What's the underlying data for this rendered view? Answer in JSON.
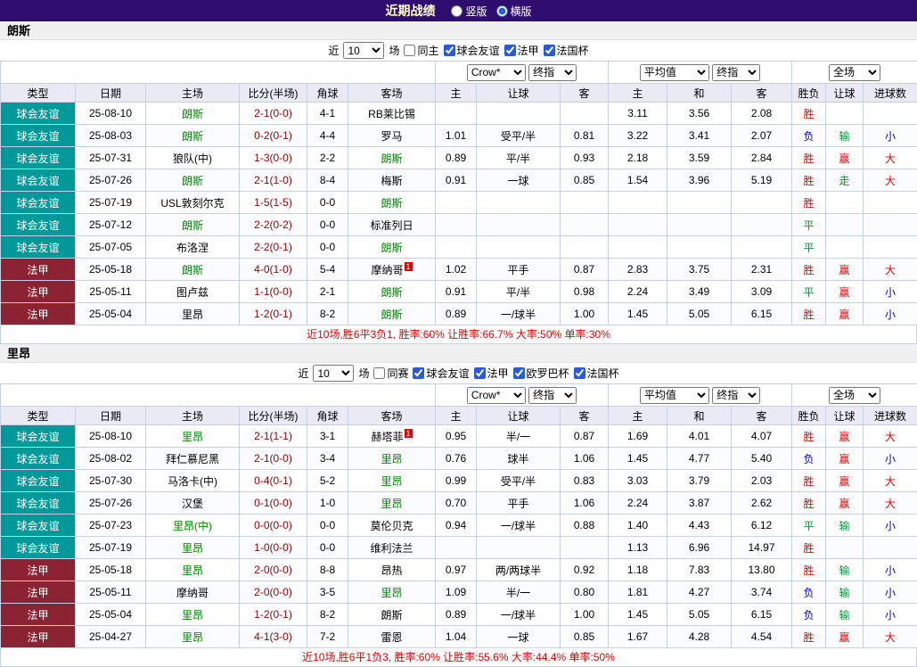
{
  "colors": {
    "topbar-bg": "#2e0d6e",
    "topbar-title": "#ffffcc",
    "accent-blue": "#2a5bd7",
    "friendly-bg": "#009999",
    "league-bg": "#8b2333",
    "focal-team": "#008800",
    "score": "#990000",
    "red": "#e60000",
    "green": "#009933",
    "blue": "#0000cc",
    "header-bg": "#e9eaf4",
    "grid": "#c6cfe3",
    "teambar-bg": "#f0f0f0",
    "summary": "#e60000"
  },
  "topbar": {
    "title": "近期战绩",
    "radios": [
      {
        "label": "竖版",
        "checked": false
      },
      {
        "label": "横版",
        "checked": true
      }
    ]
  },
  "tables": [
    {
      "team": "朗斯",
      "filter": {
        "prefix": "近",
        "count": "10",
        "suffix": "场",
        "options": [
          {
            "label": "同主",
            "checked": false
          },
          {
            "label": "球会友谊",
            "checked": true
          },
          {
            "label": "法甲",
            "checked": true
          },
          {
            "label": "法国杯",
            "checked": true
          }
        ]
      },
      "dropdowns": {
        "odds_company": "Crow*",
        "odds_time": "终指",
        "average": "平均值",
        "average_time": "终指",
        "scope": "全场"
      },
      "columns": [
        "类型",
        "日期",
        "主场",
        "比分(半场)",
        "角球",
        "客场",
        "主",
        "让球",
        "客",
        "主",
        "和",
        "客",
        "胜负",
        "让球",
        "进球数"
      ],
      "rows": [
        {
          "type": "球会友谊",
          "date": "25-08-10",
          "home": "朗斯",
          "home_focal": true,
          "score": "2-1(0-0)",
          "corners": "4-1",
          "away": "RB莱比锡",
          "away_focal": false,
          "odds": [
            "",
            "",
            ""
          ],
          "avg": [
            "3.11",
            "3.56",
            "2.08"
          ],
          "result": "胜",
          "handicap": "",
          "goals": ""
        },
        {
          "type": "球会友谊",
          "date": "25-08-03",
          "home": "朗斯",
          "home_focal": true,
          "score": "0-2(0-1)",
          "corners": "4-4",
          "away": "罗马",
          "away_focal": false,
          "odds": [
            "1.01",
            "受平/半",
            "0.81"
          ],
          "avg": [
            "3.22",
            "3.41",
            "2.07"
          ],
          "result": "负",
          "handicap": "输",
          "goals": "小"
        },
        {
          "type": "球会友谊",
          "date": "25-07-31",
          "home": "狼队(中)",
          "home_focal": false,
          "score": "1-3(0-0)",
          "corners": "2-2",
          "away": "朗斯",
          "away_focal": true,
          "odds": [
            "0.89",
            "平/半",
            "0.93"
          ],
          "avg": [
            "2.18",
            "3.59",
            "2.84"
          ],
          "result": "胜",
          "handicap": "赢",
          "goals": "大"
        },
        {
          "type": "球会友谊",
          "date": "25-07-26",
          "home": "朗斯",
          "home_focal": true,
          "score": "2-1(1-0)",
          "corners": "8-4",
          "away": "梅斯",
          "away_focal": false,
          "odds": [
            "0.91",
            "一球",
            "0.85"
          ],
          "avg": [
            "1.54",
            "3.96",
            "5.19"
          ],
          "result": "胜",
          "handicap": "走",
          "goals": "大"
        },
        {
          "type": "球会友谊",
          "date": "25-07-19",
          "home": "USL敦刻尔克",
          "home_focal": false,
          "score": "1-5(1-5)",
          "corners": "0-0",
          "away": "朗斯",
          "away_focal": true,
          "odds": [
            "",
            "",
            ""
          ],
          "avg": [
            "",
            "",
            ""
          ],
          "result": "胜",
          "handicap": "",
          "goals": ""
        },
        {
          "type": "球会友谊",
          "date": "25-07-12",
          "home": "朗斯",
          "home_focal": true,
          "score": "2-2(0-2)",
          "corners": "0-0",
          "away": "标准列日",
          "away_focal": false,
          "odds": [
            "",
            "",
            ""
          ],
          "avg": [
            "",
            "",
            ""
          ],
          "result": "平",
          "handicap": "",
          "goals": ""
        },
        {
          "type": "球会友谊",
          "date": "25-07-05",
          "home": "布洛涅",
          "home_focal": false,
          "score": "2-2(0-1)",
          "corners": "0-0",
          "away": "朗斯",
          "away_focal": true,
          "odds": [
            "",
            "",
            ""
          ],
          "avg": [
            "",
            "",
            ""
          ],
          "result": "平",
          "handicap": "",
          "goals": ""
        },
        {
          "type": "法甲",
          "date": "25-05-18",
          "home": "朗斯",
          "home_focal": true,
          "score": "4-0(1-0)",
          "corners": "5-4",
          "away": "摩纳哥",
          "away_focal": false,
          "away_rank": "1",
          "odds": [
            "1.02",
            "平手",
            "0.87"
          ],
          "avg": [
            "2.83",
            "3.75",
            "2.31"
          ],
          "result": "胜",
          "handicap": "赢",
          "goals": "大"
        },
        {
          "type": "法甲",
          "date": "25-05-11",
          "home": "图卢兹",
          "home_focal": false,
          "score": "1-1(0-0)",
          "corners": "2-1",
          "away": "朗斯",
          "away_focal": true,
          "odds": [
            "0.91",
            "平/半",
            "0.98"
          ],
          "avg": [
            "2.24",
            "3.49",
            "3.09"
          ],
          "result": "平",
          "handicap": "赢",
          "goals": "小"
        },
        {
          "type": "法甲",
          "date": "25-05-04",
          "home": "里昂",
          "home_focal": false,
          "score": "1-2(0-1)",
          "corners": "8-2",
          "away": "朗斯",
          "away_focal": true,
          "odds": [
            "0.89",
            "一/球半",
            "1.00"
          ],
          "avg": [
            "1.45",
            "5.05",
            "6.15"
          ],
          "result": "胜",
          "handicap": "赢",
          "goals": "小"
        }
      ],
      "summary": "近10场,胜6平3负1, 胜率:60% 让胜率:66.7% 大率:50% 单率:30%"
    },
    {
      "team": "里昂",
      "filter": {
        "prefix": "近",
        "count": "10",
        "suffix": "场",
        "options": [
          {
            "label": "同赛",
            "checked": false
          },
          {
            "label": "球会友谊",
            "checked": true
          },
          {
            "label": "法甲",
            "checked": true
          },
          {
            "label": "欧罗巴杯",
            "checked": true
          },
          {
            "label": "法国杯",
            "checked": true
          }
        ]
      },
      "dropdowns": {
        "odds_company": "Crow*",
        "odds_time": "终指",
        "average": "平均值",
        "average_time": "终指",
        "scope": "全场"
      },
      "columns": [
        "类型",
        "日期",
        "主场",
        "比分(半场)",
        "角球",
        "客场",
        "主",
        "让球",
        "客",
        "主",
        "和",
        "客",
        "胜负",
        "让球",
        "进球数"
      ],
      "rows": [
        {
          "type": "球会友谊",
          "date": "25-08-10",
          "home": "里昂",
          "home_focal": true,
          "score": "2-1(1-1)",
          "corners": "3-1",
          "away": "赫塔菲",
          "away_focal": false,
          "away_rank": "1",
          "odds": [
            "0.95",
            "半/一",
            "0.87"
          ],
          "avg": [
            "1.69",
            "4.01",
            "4.07"
          ],
          "result": "胜",
          "handicap": "赢",
          "goals": "大"
        },
        {
          "type": "球会友谊",
          "date": "25-08-02",
          "home": "拜仁慕尼黑",
          "home_focal": false,
          "score": "2-1(0-0)",
          "corners": "3-4",
          "away": "里昂",
          "away_focal": true,
          "odds": [
            "0.76",
            "球半",
            "1.06"
          ],
          "avg": [
            "1.45",
            "4.77",
            "5.40"
          ],
          "result": "负",
          "handicap": "赢",
          "goals": "小"
        },
        {
          "type": "球会友谊",
          "date": "25-07-30",
          "home": "马洛卡(中)",
          "home_focal": false,
          "score": "0-4(0-1)",
          "corners": "5-2",
          "away": "里昂",
          "away_focal": true,
          "odds": [
            "0.99",
            "受平/半",
            "0.83"
          ],
          "avg": [
            "3.03",
            "3.79",
            "2.03"
          ],
          "result": "胜",
          "handicap": "赢",
          "goals": "大"
        },
        {
          "type": "球会友谊",
          "date": "25-07-26",
          "home": "汉堡",
          "home_focal": false,
          "score": "0-1(0-0)",
          "corners": "1-0",
          "away": "里昂",
          "away_focal": true,
          "odds": [
            "0.70",
            "平手",
            "1.06"
          ],
          "avg": [
            "2.24",
            "3.87",
            "2.62"
          ],
          "result": "胜",
          "handicap": "赢",
          "goals": "大"
        },
        {
          "type": "球会友谊",
          "date": "25-07-23",
          "home": "里昂(中)",
          "home_focal": true,
          "score": "0-0(0-0)",
          "corners": "0-0",
          "away": "莫伦贝克",
          "away_focal": false,
          "odds": [
            "0.94",
            "一/球半",
            "0.88"
          ],
          "avg": [
            "1.40",
            "4.43",
            "6.12"
          ],
          "result": "平",
          "handicap": "输",
          "goals": "小"
        },
        {
          "type": "球会友谊",
          "date": "25-07-19",
          "home": "里昂",
          "home_focal": true,
          "score": "1-0(0-0)",
          "corners": "0-0",
          "away": "维利法兰",
          "away_focal": false,
          "odds": [
            "",
            "",
            ""
          ],
          "avg": [
            "1.13",
            "6.96",
            "14.97"
          ],
          "result": "胜",
          "handicap": "",
          "goals": ""
        },
        {
          "type": "法甲",
          "date": "25-05-18",
          "home": "里昂",
          "home_focal": true,
          "score": "2-0(0-0)",
          "corners": "8-8",
          "away": "昂热",
          "away_focal": false,
          "odds": [
            "0.97",
            "两/两球半",
            "0.92"
          ],
          "avg": [
            "1.18",
            "7.83",
            "13.80"
          ],
          "result": "胜",
          "handicap": "输",
          "goals": "小"
        },
        {
          "type": "法甲",
          "date": "25-05-11",
          "home": "摩纳哥",
          "home_focal": false,
          "score": "2-0(0-0)",
          "corners": "3-5",
          "away": "里昂",
          "away_focal": true,
          "odds": [
            "1.09",
            "半/一",
            "0.80"
          ],
          "avg": [
            "1.81",
            "4.27",
            "3.74"
          ],
          "result": "负",
          "handicap": "输",
          "goals": "小"
        },
        {
          "type": "法甲",
          "date": "25-05-04",
          "home": "里昂",
          "home_focal": true,
          "score": "1-2(0-1)",
          "corners": "8-2",
          "away": "朗斯",
          "away_focal": false,
          "odds": [
            "0.89",
            "一/球半",
            "1.00"
          ],
          "avg": [
            "1.45",
            "5.05",
            "6.15"
          ],
          "result": "负",
          "handicap": "输",
          "goals": "小"
        },
        {
          "type": "法甲",
          "date": "25-04-27",
          "home": "里昂",
          "home_focal": true,
          "score": "4-1(3-0)",
          "corners": "7-2",
          "away": "雷恩",
          "away_focal": false,
          "odds": [
            "1.04",
            "一球",
            "0.85"
          ],
          "avg": [
            "1.67",
            "4.28",
            "4.54"
          ],
          "result": "胜",
          "handicap": "赢",
          "goals": "大"
        }
      ],
      "summary": "近10场,胜6平1负3, 胜率:60% 让胜率:55.6% 大率:44.4% 单率:50%"
    }
  ]
}
